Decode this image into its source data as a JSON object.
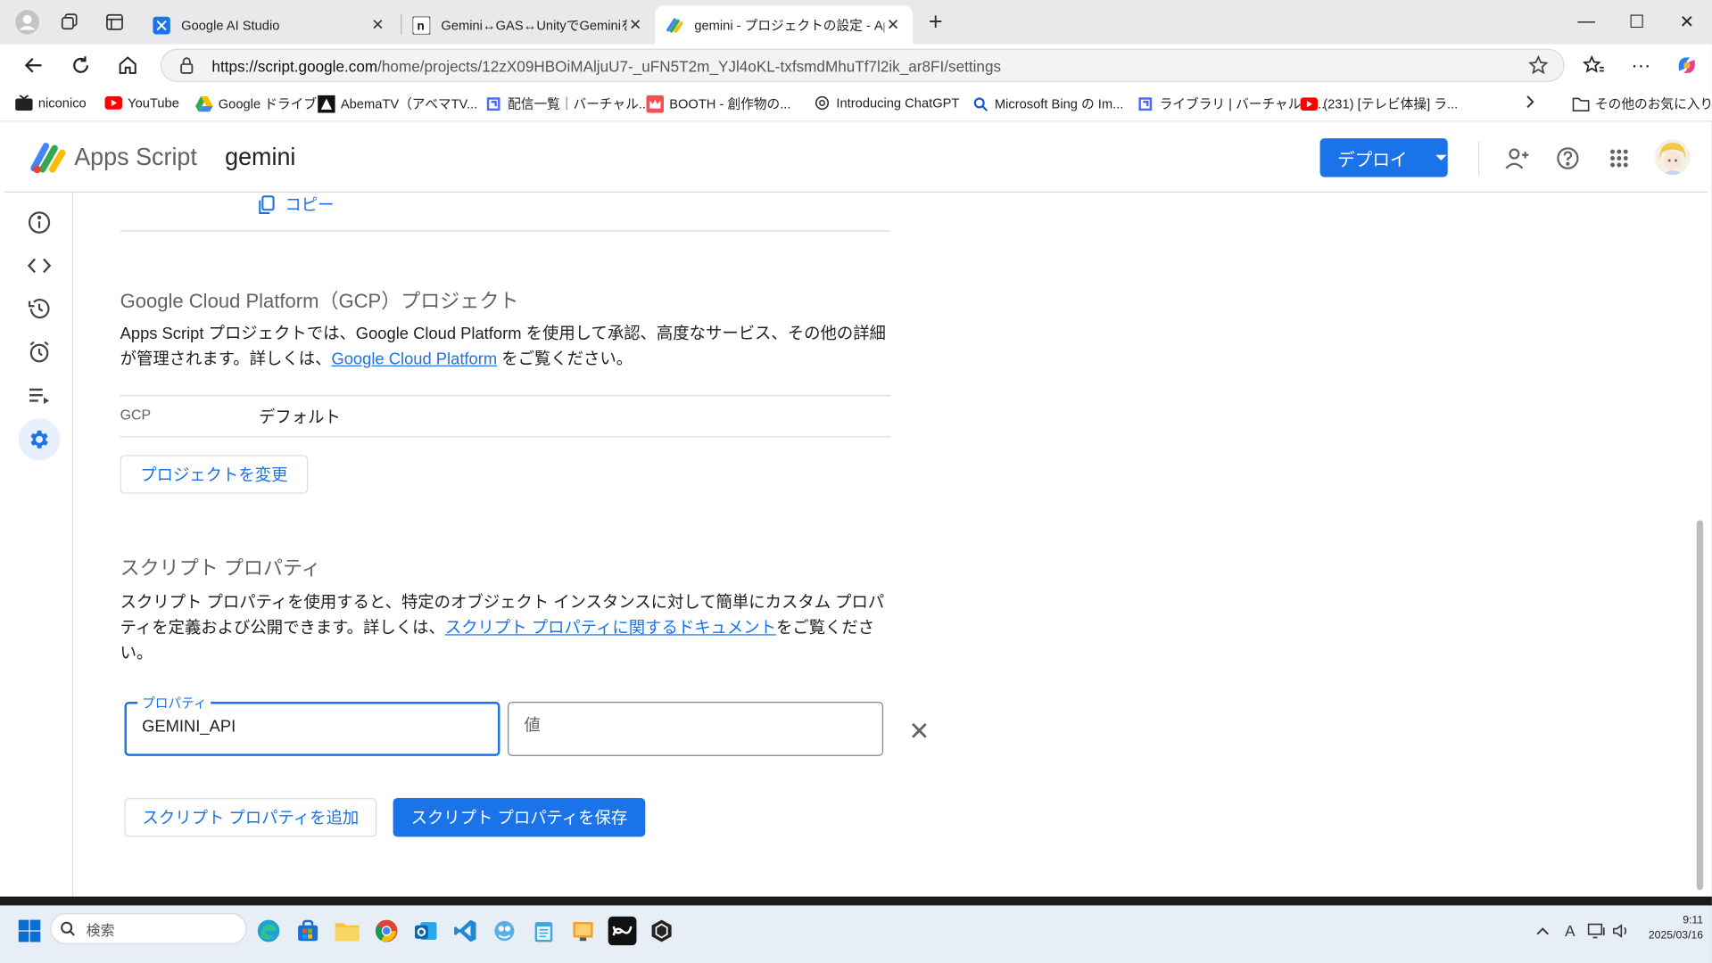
{
  "browser": {
    "tabs": [
      {
        "title": "Google AI Studio",
        "icon": "ai-studio-icon"
      },
      {
        "title": "Gemini↔GAS↔UnityでGeminiを使",
        "icon": "note-icon"
      },
      {
        "title": "gemini - プロジェクトの設定 - Apps S",
        "icon": "apps-script-icon"
      }
    ],
    "url_host": "https://script.google.com",
    "url_path": "/home/projects/12zX09HBOiMAljuU7-_uFN5T2m_YJl4oKL-txfsmdMhuTf7l2ik_ar8FI/settings",
    "bookmarks": [
      {
        "label": "niconico",
        "icon": "niconico-icon"
      },
      {
        "label": "YouTube",
        "icon": "youtube-icon"
      },
      {
        "label": "Google ドライブ",
        "icon": "drive-icon"
      },
      {
        "label": "AbemaTV（アベマTV...",
        "icon": "abema-icon"
      },
      {
        "label": "配信一覧｜バーチャル...",
        "icon": "virtual-icon"
      },
      {
        "label": "BOOTH - 創作物の...",
        "icon": "booth-icon"
      },
      {
        "label": "Introducing ChatGPT",
        "icon": "openai-icon"
      },
      {
        "label": "Microsoft Bing の Im...",
        "icon": "bing-icon"
      },
      {
        "label": "ライブラリ | バーチャルキ...",
        "icon": "virtual-icon"
      },
      {
        "label": "(231) [テレビ体操] ラ...",
        "icon": "youtube-icon"
      }
    ],
    "other_bookmarks": "その他のお気に入り"
  },
  "app": {
    "brand": "Apps Script",
    "project": "gemini",
    "deploy_label": "デプロイ"
  },
  "content": {
    "copy_label": "コピー",
    "gcp": {
      "title": "Google Cloud Platform（GCP）プロジェクト",
      "desc_before": "Apps Script プロジェクトでは、Google Cloud Platform を使用して承認、高度なサービス、その他の詳細が管理されます。詳しくは、",
      "desc_link": "Google Cloud Platform",
      "desc_after": " をご覧ください。",
      "row_label": "GCP",
      "row_value": "デフォルト",
      "change_button": "プロジェクトを変更"
    },
    "props": {
      "title": "スクリプト プロパティ",
      "desc_before": "スクリプト プロパティを使用すると、特定のオブジェクト インスタンスに対して簡単にカスタム プロパティを定義および公開できます。詳しくは、",
      "desc_link": "スクリプト プロパティに関するドキュメント",
      "desc_after": "をご覧ください。",
      "property_label": "プロパティ",
      "property_value": "GEMINI_API",
      "value_placeholder": "値",
      "add_button": "スクリプト プロパティを追加",
      "save_button": "スクリプト プロパティを保存"
    }
  },
  "taskbar": {
    "search_placeholder": "検索",
    "time": "9:11",
    "date": "2025/03/16"
  },
  "colors": {
    "accent": "#1a73e8",
    "rail_active_bg": "#e8f0fe"
  }
}
